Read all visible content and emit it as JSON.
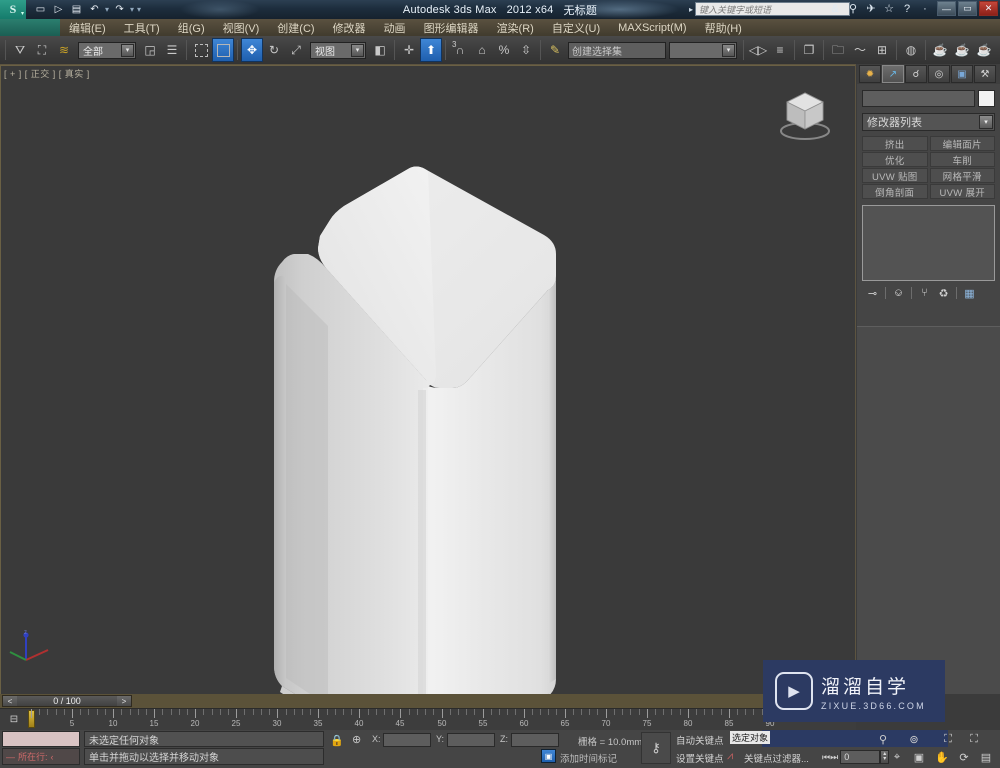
{
  "titlebar": {
    "app_name": "Autodesk 3ds Max",
    "version": "2012 x64",
    "document": "无标题",
    "logo_glyph": "S",
    "quick_access": [
      {
        "name": "new-file-icon",
        "glyph": "▭"
      },
      {
        "name": "open-file-icon",
        "glyph": "▷"
      },
      {
        "name": "save-file-icon",
        "glyph": "▤"
      },
      {
        "name": "undo-icon",
        "glyph": "↶"
      },
      {
        "name": "undo-dropdown-icon",
        "glyph": "▾"
      },
      {
        "name": "redo-icon",
        "glyph": "↷"
      },
      {
        "name": "redo-dropdown-icon",
        "glyph": "▾"
      },
      {
        "name": "qat-customize-icon",
        "glyph": "▾"
      }
    ],
    "search_placeholder": "键入关键字或短语",
    "info_icons": [
      {
        "name": "autodesk-360-icon",
        "glyph": "&"
      },
      {
        "name": "search-icon",
        "glyph": "⚲"
      },
      {
        "name": "exchange-icon",
        "glyph": "✈"
      },
      {
        "name": "favorites-star-icon",
        "glyph": "☆"
      },
      {
        "name": "help-icon",
        "glyph": "?"
      },
      {
        "name": "help-dropdown-icon",
        "glyph": "·"
      }
    ],
    "window_controls": [
      {
        "name": "minimize-button",
        "glyph": "—"
      },
      {
        "name": "maximize-button",
        "glyph": "▭"
      },
      {
        "name": "close-button",
        "glyph": "✕"
      }
    ]
  },
  "menubar": {
    "items": [
      {
        "label": "编辑(E)"
      },
      {
        "label": "工具(T)"
      },
      {
        "label": "组(G)"
      },
      {
        "label": "视图(V)"
      },
      {
        "label": "创建(C)"
      },
      {
        "label": "修改器"
      },
      {
        "label": "动画"
      },
      {
        "label": "图形编辑器"
      },
      {
        "label": "渲染(R)"
      },
      {
        "label": "自定义(U)"
      },
      {
        "label": "MAXScript(M)"
      },
      {
        "label": "帮助(H)"
      }
    ]
  },
  "toolbar": {
    "selection_filter_value": "全部",
    "reference_coord_value": "视图",
    "selection_set_placeholder": "创建选择集",
    "named_set_value": "",
    "buttons": [
      {
        "name": "select-and-link-icon",
        "glyph": "⚷"
      },
      {
        "name": "unlink-selection-icon",
        "glyph": "⚷"
      },
      {
        "name": "bind-to-space-warp-icon",
        "glyph": "≋"
      },
      {
        "name": "select-object-icon",
        "glyph": "◱"
      },
      {
        "name": "select-by-name-icon",
        "glyph": "☰"
      },
      {
        "name": "rectangular-selection-region-icon",
        "glyph": ""
      },
      {
        "name": "window-crossing-toggle-icon",
        "glyph": "▣"
      },
      {
        "name": "select-and-move-icon",
        "glyph": "✜"
      },
      {
        "name": "select-and-rotate-icon",
        "glyph": "↻"
      },
      {
        "name": "select-and-scale-icon",
        "glyph": "⤢"
      },
      {
        "name": "use-pivot-center-icon",
        "glyph": "◈"
      },
      {
        "name": "mirror-icon",
        "glyph": "◁"
      },
      {
        "name": "align-icon",
        "glyph": "≡"
      },
      {
        "name": "layer-manager-icon",
        "glyph": "≣"
      },
      {
        "name": "toggle-scene-explorer-icon",
        "glyph": "☷"
      },
      {
        "name": "curve-editor-icon",
        "glyph": "⌇"
      },
      {
        "name": "schematic-view-icon",
        "glyph": "⊞"
      },
      {
        "name": "material-editor-icon",
        "glyph": "◍"
      },
      {
        "name": "render-setup-icon",
        "glyph": "☕"
      },
      {
        "name": "rendered-frame-window-icon",
        "glyph": "☕"
      },
      {
        "name": "render-production-icon",
        "glyph": "☕"
      },
      {
        "name": "snaps-toggle-icon",
        "glyph": "∩"
      },
      {
        "name": "angle-snap-toggle-icon",
        "glyph": "∠"
      },
      {
        "name": "percent-snap-toggle-icon",
        "glyph": "%"
      },
      {
        "name": "spinner-snap-toggle-icon",
        "glyph": "↕"
      },
      {
        "name": "edit-named-selection-sets-icon",
        "glyph": "✎"
      }
    ]
  },
  "viewport": {
    "label": "[ + ] [ 正交 ] [ 真实 ]",
    "view_type": "正交",
    "shading": "真实",
    "object": {
      "name": "chamfered-hexagonal-prism",
      "fill_light": "#eeeeee",
      "fill_mid": "#dcdcdc",
      "fill_dark": "#c3c3c3",
      "background": "#3a3a3a"
    },
    "viewcube_label": "",
    "tripod": {
      "x_color": "#b03030",
      "y_color": "#2f8f3f",
      "z_color": "#3040c0",
      "z_label": "z"
    }
  },
  "command_panel": {
    "tabs": [
      {
        "name": "create-tab",
        "glyph": "✹",
        "active": false
      },
      {
        "name": "modify-tab",
        "glyph": "↗",
        "active": true
      },
      {
        "name": "hierarchy-tab",
        "glyph": "☌",
        "active": false
      },
      {
        "name": "motion-tab",
        "glyph": "◎",
        "active": false
      },
      {
        "name": "display-tab",
        "glyph": "▣",
        "active": false
      },
      {
        "name": "utilities-tab",
        "glyph": "⚒",
        "active": false
      }
    ],
    "object_name": "",
    "object_color": "#f2f2f2",
    "modifier_list_label": "修改器列表",
    "modifier_buttons": [
      {
        "label": "挤出"
      },
      {
        "label": "编辑面片"
      },
      {
        "label": "优化"
      },
      {
        "label": "车削"
      },
      {
        "label": "UVW 贴图"
      },
      {
        "label": "网格平滑"
      },
      {
        "label": "倒角剖面"
      },
      {
        "label": "UVW 展开"
      }
    ],
    "stack_items": [],
    "stack_icons": [
      {
        "name": "pin-stack-icon",
        "glyph": "⊸"
      },
      {
        "name": "show-end-result-icon",
        "glyph": "⎉"
      },
      {
        "name": "make-unique-icon",
        "glyph": "⑂"
      },
      {
        "name": "remove-modifier-icon",
        "glyph": "♻"
      },
      {
        "name": "configure-modifier-sets-icon",
        "glyph": "▦"
      }
    ]
  },
  "timeline": {
    "slider_value": "0 / 100",
    "prev_frame_glyph": "<",
    "next_frame_glyph": ">",
    "current_frame": 0,
    "range_start": 0,
    "range_end": 100,
    "tick_labels": [
      5,
      10,
      15,
      20,
      25,
      30,
      35,
      40,
      45,
      50,
      55,
      60,
      65,
      70,
      75,
      80,
      85,
      90
    ],
    "key_mode_icon": "set-key-mode-icon"
  },
  "statusbar": {
    "mini_listener_line_label": "所在行:",
    "mini_listener_prompt": "—",
    "selection_status": "未选定任何对象",
    "prompt": "单击并拖动以选择并移动对象",
    "lock_selection_icon": "lock-icon",
    "absolute_mode_icon": "absolute-relative-transform-icon",
    "coords": [
      {
        "label": "X:",
        "value": ""
      },
      {
        "label": "Y:",
        "value": ""
      },
      {
        "label": "Z:",
        "value": ""
      }
    ],
    "grid_label": "栅格 = 10.0mm",
    "add_time_tag": "添加时间标记",
    "auto_key": "自动关键点",
    "set_key": "设置关键点",
    "selection_list_value": "选定对象",
    "key_filters": "关键点过滤器...",
    "spinner_value": "0",
    "nav_icons": [
      {
        "name": "zoom-icon",
        "glyph": "⚲"
      },
      {
        "name": "zoom-all-icon",
        "glyph": "⊚"
      },
      {
        "name": "zoom-extents-icon",
        "glyph": "⛶"
      },
      {
        "name": "zoom-region-icon",
        "glyph": "▣"
      },
      {
        "name": "pan-view-icon",
        "glyph": "✋"
      },
      {
        "name": "orbit-icon",
        "glyph": "⟳"
      },
      {
        "name": "maximize-viewport-toggle-icon",
        "glyph": "▤"
      }
    ]
  },
  "watermark": {
    "cn_text": "溜溜自学",
    "en_text": "ZIXUE.3D66.COM",
    "play_glyph": "▶",
    "bg_color": "#2c3a62"
  }
}
